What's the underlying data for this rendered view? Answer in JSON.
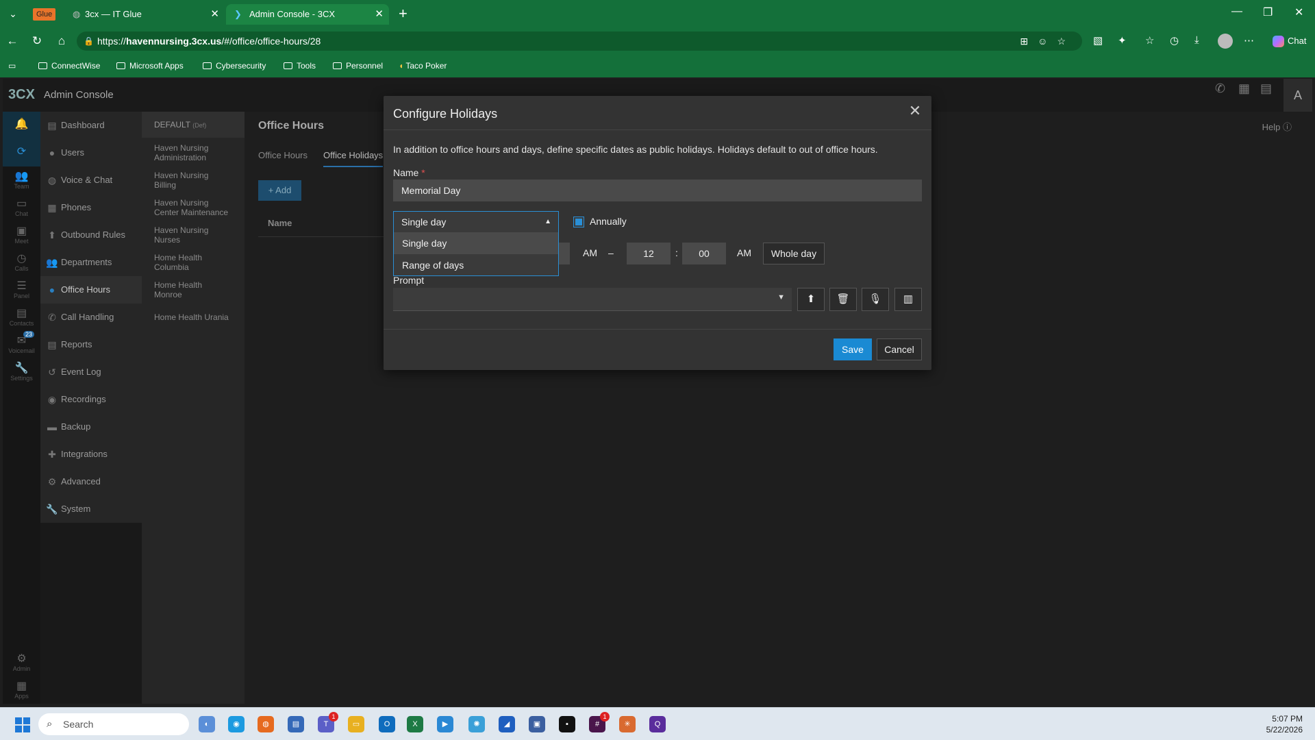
{
  "browser": {
    "tabs": [
      {
        "badge": "Glue",
        "title": "3cx — IT Glue"
      },
      {
        "title": "Admin Console - 3CX"
      }
    ],
    "url_prefix": "https://",
    "url_host": "havennursing.3cx.us",
    "url_path": "/#/office/office-hours/28",
    "chat_label": "Chat",
    "bookmarks": [
      "ConnectWise",
      "Microsoft Apps",
      "Cybersecurity",
      "Tools",
      "Personnel",
      "Taco Poker"
    ]
  },
  "app": {
    "logo": "3CX",
    "title": "Admin Console",
    "avatar_letter": "A",
    "rail": [
      "Team",
      "Chat",
      "Meet",
      "Calls",
      "Panel",
      "Contacts",
      "Voicemail",
      "Settings",
      "Admin",
      "Apps"
    ],
    "voicemail_count": "23",
    "nav": [
      "Dashboard",
      "Users",
      "Voice & Chat",
      "Phones",
      "Outbound Rules",
      "Departments",
      "Office Hours",
      "Call Handling",
      "Reports",
      "Event Log",
      "Recordings",
      "Backup",
      "Integrations",
      "Advanced",
      "System"
    ],
    "sites_default": "DEFAULT",
    "sites_default_tag": "(Def)",
    "sites": [
      [
        "Haven Nursing",
        "Administration"
      ],
      [
        "Haven Nursing",
        "Billing"
      ],
      [
        "Haven Nursing",
        "Center Maintenance"
      ],
      [
        "Haven Nursing",
        "Nurses"
      ],
      [
        "Home Health",
        "Columbia"
      ],
      [
        "Home Health",
        "Monroe"
      ],
      [
        "Home Health Urania",
        ""
      ]
    ],
    "content_title": "Office Hours",
    "help_label": "Help",
    "tabs": [
      "Office Hours",
      "Office Holidays"
    ],
    "add_label": "+ Add",
    "col_name": "Name"
  },
  "modal": {
    "title": "Configure Holidays",
    "description": "In addition to office hours and days, define specific dates as public holidays. Holidays default to out of office hours.",
    "name_label": "Name",
    "required_mark": "*",
    "name_value": "Memorial Day",
    "type_selected": "Single day",
    "type_options": [
      "Single day",
      "Range of days"
    ],
    "annually_label": "Annually",
    "annually_checked": true,
    "start_ampm": "AM",
    "dash": "–",
    "end_hour": "12",
    "colon": ":",
    "end_min": "00",
    "end_ampm": "AM",
    "whole_day_label": "Whole day",
    "prompt_label": "Prompt",
    "save_label": "Save",
    "cancel_label": "Cancel"
  },
  "taskbar": {
    "search_placeholder": "Search",
    "teams_badge": "1",
    "slack_badge": "1",
    "time": "5:07 PM",
    "date": "5/22/2026"
  },
  "colors": {
    "browser_green": "#14703a",
    "accent_blue": "#1a8ad3"
  }
}
